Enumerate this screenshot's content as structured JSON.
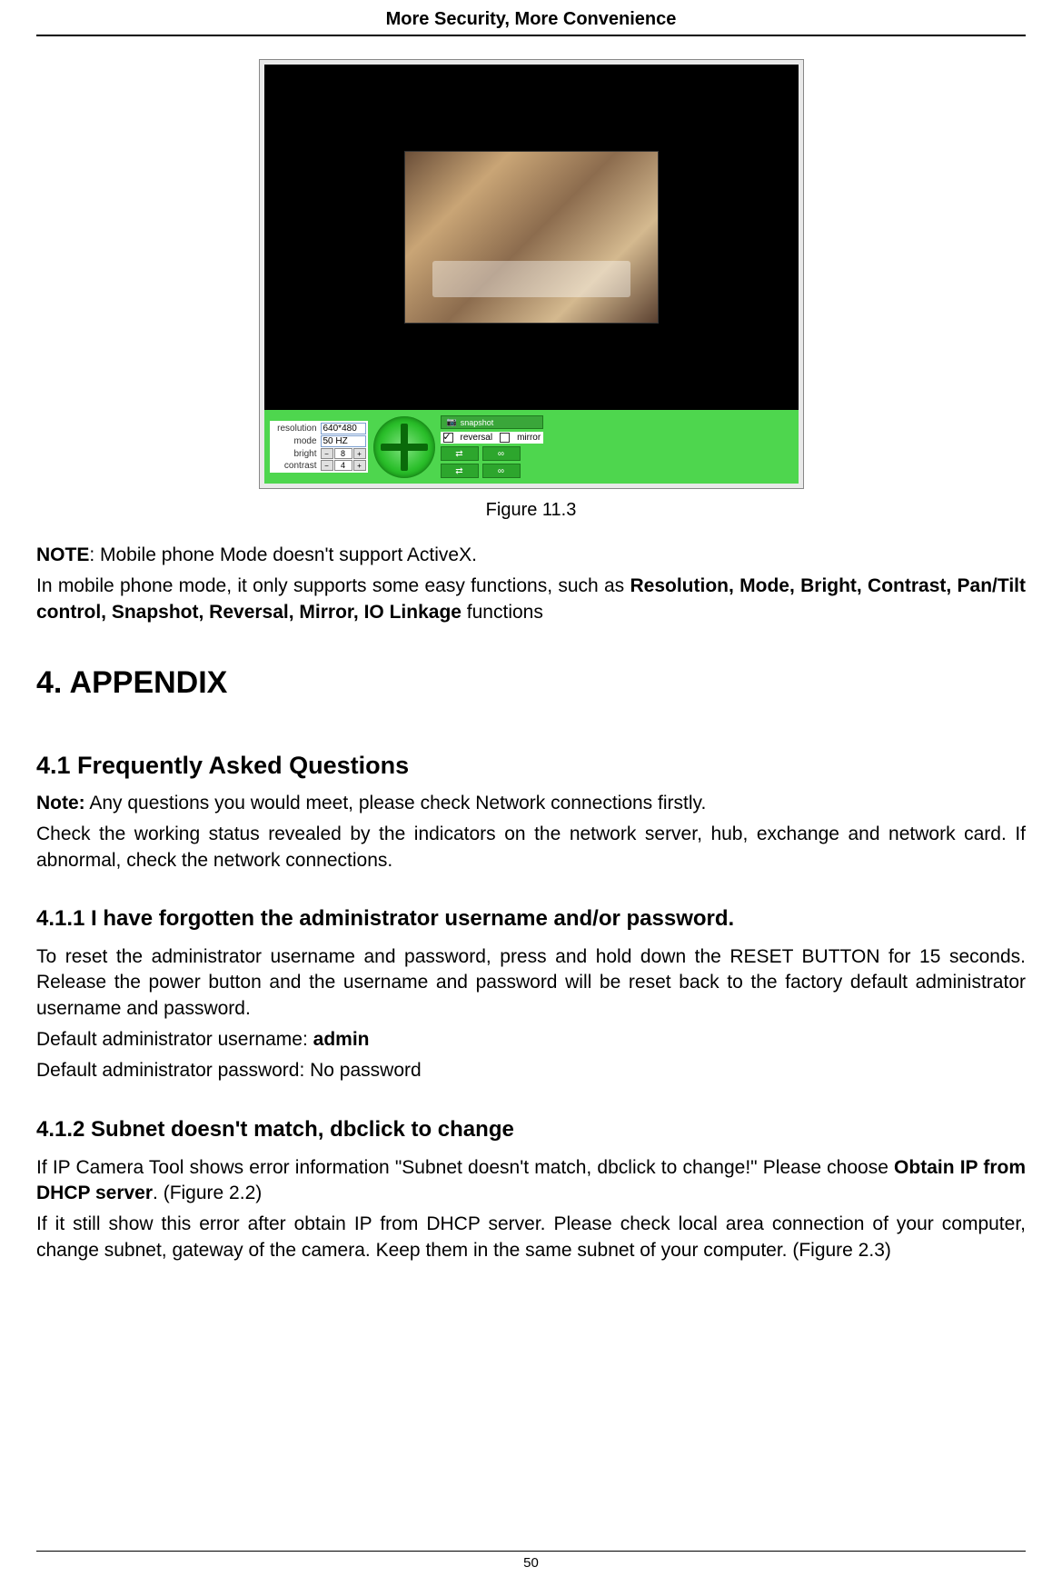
{
  "header": {
    "title": "More Security, More Convenience"
  },
  "figure": {
    "caption": "Figure 11.3",
    "controls": {
      "resolution_label": "resolution",
      "resolution_value": "640*480",
      "mode_label": "mode",
      "mode_value": "50 HZ",
      "bright_label": "bright",
      "bright_value": "8",
      "contrast_label": "contrast",
      "contrast_value": "4",
      "snapshot_label": "snapshot",
      "reversal_label": "reversal",
      "reversal_checked": true,
      "mirror_label": "mirror",
      "mirror_checked": false,
      "io_on": "⇄",
      "io_off": "∞",
      "io_on2": "⇄",
      "io_off2": "∞"
    }
  },
  "note": {
    "prefix": "NOTE",
    "line1_rest": ": Mobile phone Mode doesn't support ActiveX.",
    "line2_pre": "In mobile phone mode, it only supports some easy functions, such as ",
    "line2_bold": "Resolution, Mode, Bright, Contrast, Pan/Tilt control, Snapshot, Reversal, Mirror, IO Linkage",
    "line2_post": " functions"
  },
  "appendix_heading": "4. APPENDIX",
  "faq_heading": "4.1 Frequently Asked Questions",
  "faq_note_bold": "Note:",
  "faq_note_rest": " Any questions you would meet, please check Network connections firstly.",
  "faq_note_line2": "Check the working status revealed by the indicators on the network server, hub, exchange and network card. If abnormal, check the network connections.",
  "s411_heading": "4.1.1 I have forgotten the administrator username and/or password.",
  "s411_p1": "To reset the administrator username and password, press and hold down the RESET BUTTON for 15 seconds. Release the power button and the username and password will be reset back to the factory default administrator username and password.",
  "s411_user_pre": "Default administrator username: ",
  "s411_user_bold": "admin",
  "s411_pass": "Default administrator password: No password",
  "s412_heading": "4.1.2 Subnet doesn't match, dbclick to change",
  "s412_p1_pre": "If IP Camera Tool shows error information \"Subnet doesn't match, dbclick to change!\" Please choose ",
  "s412_p1_bold": "Obtain IP from DHCP server",
  "s412_p1_post": ". (Figure 2.2)",
  "s412_p2": "If it still show this error after obtain IP from DHCP server. Please check local area connection of your computer, change subnet, gateway of the camera. Keep them in the same subnet of your computer. (Figure 2.3)",
  "page_number": "50"
}
